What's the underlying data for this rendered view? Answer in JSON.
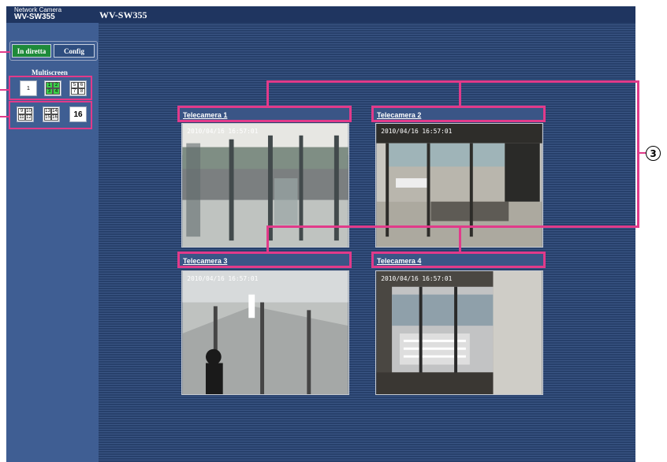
{
  "header": {
    "brand_small": "Network Camera",
    "brand_model": "WV-SW355",
    "title": "WV-SW355"
  },
  "tabs": {
    "live_label": "In diretta",
    "config_label": "Config",
    "active": "In diretta"
  },
  "multiscreen": {
    "label": "Multiscreen",
    "buttons": [
      {
        "name": "single",
        "cells": [
          "1"
        ],
        "active": false
      },
      {
        "name": "quad-1-4",
        "cells": [
          "1",
          "2",
          "3",
          "4"
        ],
        "active": true
      },
      {
        "name": "quad-5-8",
        "cells": [
          "5",
          "6",
          "7",
          "8"
        ],
        "active": false
      },
      {
        "name": "quad-9-12",
        "cells": [
          "9",
          "10",
          "11",
          "12"
        ],
        "active": false
      },
      {
        "name": "quad-13-16",
        "cells": [
          "13",
          "14",
          "15",
          "16"
        ],
        "active": false
      },
      {
        "name": "grid-16",
        "cells": [
          "16"
        ],
        "active": false
      }
    ]
  },
  "cameras": [
    {
      "title": "Telecamera 1",
      "timestamp": "2010/04/16 16:57:01"
    },
    {
      "title": "Telecamera 2",
      "timestamp": "2010/04/16 16:57:01"
    },
    {
      "title": "Telecamera 3",
      "timestamp": "2010/04/16 16:57:01"
    },
    {
      "title": "Telecamera 4",
      "timestamp": "2010/04/16 16:57:01"
    }
  ],
  "callout": "3",
  "colors": {
    "accent_pink": "#e13a8a",
    "active_tab": "#1e8a3a",
    "header": "#1f3560",
    "sidebar": "#3f5e93"
  }
}
